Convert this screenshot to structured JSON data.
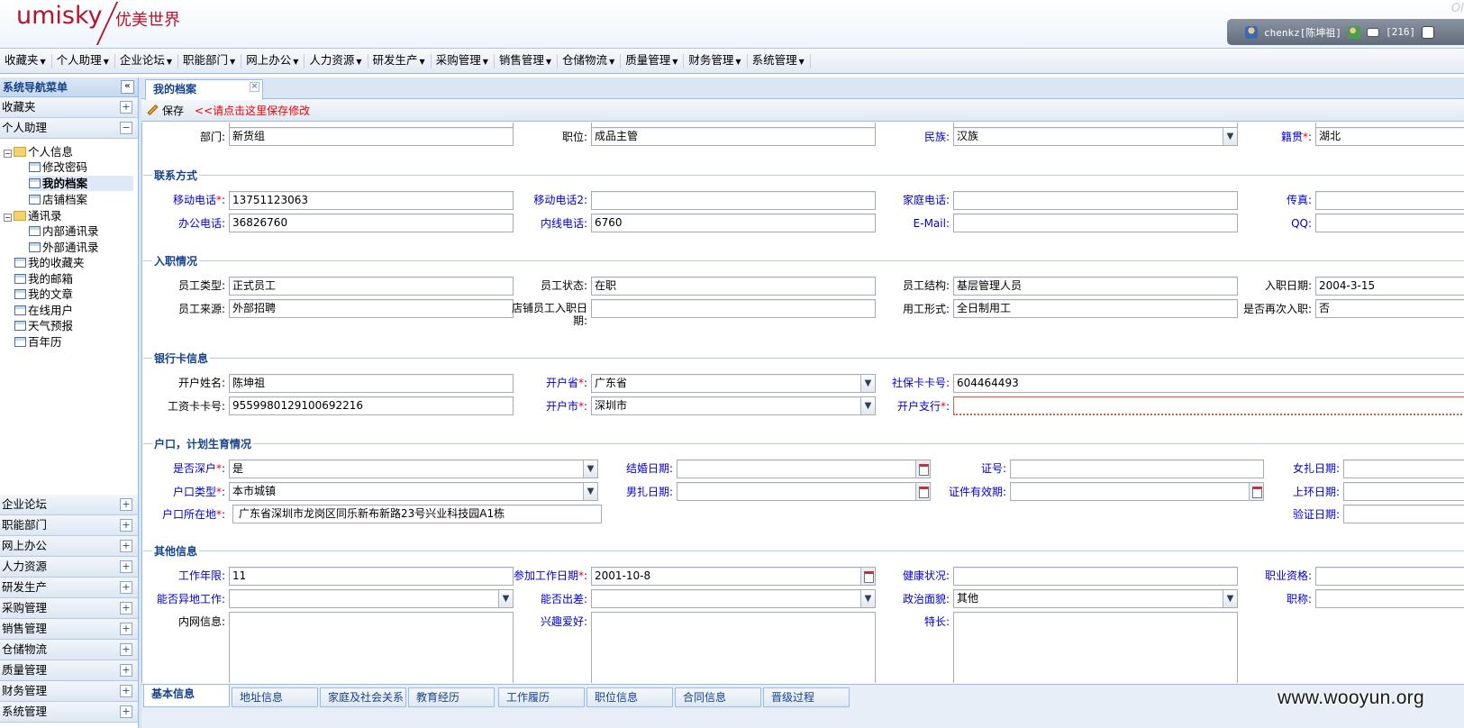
{
  "header": {
    "logo_en": "umisky",
    "logo_cn": "优美世界",
    "corner": "OI",
    "user": "chenkz[陈坤祖]",
    "mail_count": "[216]"
  },
  "menu": [
    "收藏夹",
    "个人助理",
    "企业论坛",
    "职能部门",
    "网上办公",
    "人力资源",
    "研发生产",
    "采购管理",
    "销售管理",
    "仓储物流",
    "质量管理",
    "财务管理",
    "系统管理"
  ],
  "nav": {
    "title": "系统导航菜单",
    "top_panels": [
      {
        "label": "收藏夹",
        "sign": "+"
      },
      {
        "label": "个人助理",
        "sign": "−"
      }
    ],
    "tree": {
      "personal_info": "个人信息",
      "change_pwd": "修改密码",
      "my_profile": "我的档案",
      "shop_profile": "店铺档案",
      "contacts": "通讯录",
      "internal_contacts": "内部通讯录",
      "external_contacts": "外部通讯录",
      "favorites": "我的收藏夹",
      "mailbox": "我的邮箱",
      "articles": "我的文章",
      "online_users": "在线用户",
      "weather": "天气预报",
      "calendar": "百年历"
    },
    "bottom_panels": [
      "企业论坛",
      "职能部门",
      "网上办公",
      "人力资源",
      "研发生产",
      "采购管理",
      "销售管理",
      "仓储物流",
      "质量管理",
      "财务管理",
      "系统管理"
    ]
  },
  "tab": {
    "title": "我的档案",
    "close": "×"
  },
  "toolbar": {
    "save": "保存",
    "hint": "<<请点击这里保存修改"
  },
  "top_row": {
    "dept_label": "部门:",
    "dept": "新货组",
    "position_label": "职位:",
    "position": "成品主管",
    "ethnic_label": "民族:",
    "ethnic": "汉族",
    "native_label": "籍贯",
    "native": "湖北"
  },
  "contact": {
    "legend": "联系方式",
    "mobile_label": "移动电话",
    "mobile": "13751123063",
    "mobile2_label": "移动电话2:",
    "mobile2": "",
    "home_label": "家庭电话:",
    "home": "",
    "fax_label": "传真:",
    "fax": "",
    "office_label": "办公电话:",
    "office": "36826760",
    "ext_label": "内线电话:",
    "ext": "6760",
    "email_label": "E-Mail:",
    "email": "",
    "qq_label": "QQ:",
    "qq": ""
  },
  "employment": {
    "legend": "入职情况",
    "type_label": "员工类型:",
    "type": "正式员工",
    "status_label": "员工状态:",
    "status": "在职",
    "structure_label": "员工结构:",
    "structure": "基层管理人员",
    "entry_label": "入职日期:",
    "entry": "2004-3-15",
    "source_label": "员工来源:",
    "source": "外部招聘",
    "shop_entry_label": "店铺员工入职日期:",
    "shop_entry": "",
    "form_label": "用工形式:",
    "form": "全日制用工",
    "rehire_label": "是否再次入职:",
    "rehire": "否"
  },
  "bank": {
    "legend": "银行卡信息",
    "holder_label": "开户姓名:",
    "holder": "陈坤祖",
    "province_label": "开户省",
    "province": "广东省",
    "social_label": "社保卡卡号:",
    "social": "604464493",
    "card_label": "工资卡卡号:",
    "card": "9559980129100692216",
    "city_label": "开户市",
    "city": "深圳市",
    "branch_label": "开户支行",
    "branch": ""
  },
  "household": {
    "legend": "户口，计划生育情况",
    "sz_label": "是否深户",
    "sz": "是",
    "marry_label": "结婚日期:",
    "marry": "",
    "cert_label": "证号:",
    "cert": "",
    "female_label": "女扎日期:",
    "female": "",
    "type_label": "户口类型",
    "type": "本市城镇",
    "male_label": "男扎日期:",
    "male": "",
    "valid_label": "证件有效期:",
    "valid": "",
    "ring_label": "上环日期:",
    "ring": "",
    "addr_label": "户口所在地",
    "addr": "广东省深圳市龙岗区同乐新布新路23号兴业科技园A1栋",
    "verify_label": "验证日期:",
    "verify": ""
  },
  "other": {
    "legend": "其他信息",
    "years_label": "工作年限:",
    "years": "11",
    "work_date_label": "参加工作日期",
    "work_date": "2001-10-8",
    "health_label": "健康状况:",
    "health": "",
    "qual_label": "职业资格:",
    "qual": "",
    "remote_label": "能否异地工作:",
    "remote": "",
    "travel_label": "能否出差:",
    "travel": "",
    "politics_label": "政治面貌:",
    "politics": "其他",
    "title_label": "职称:",
    "title": "",
    "intranet_label": "内网信息:",
    "hobby_label": "兴趣爱好:",
    "skill_label": "特长:"
  },
  "bottom_tabs": [
    "基本信息",
    "地址信息",
    "家庭及社会关系",
    "教育经历",
    "工作履历",
    "职位信息",
    "合同信息",
    "晋级过程"
  ],
  "watermark": "www.wooyun.org"
}
